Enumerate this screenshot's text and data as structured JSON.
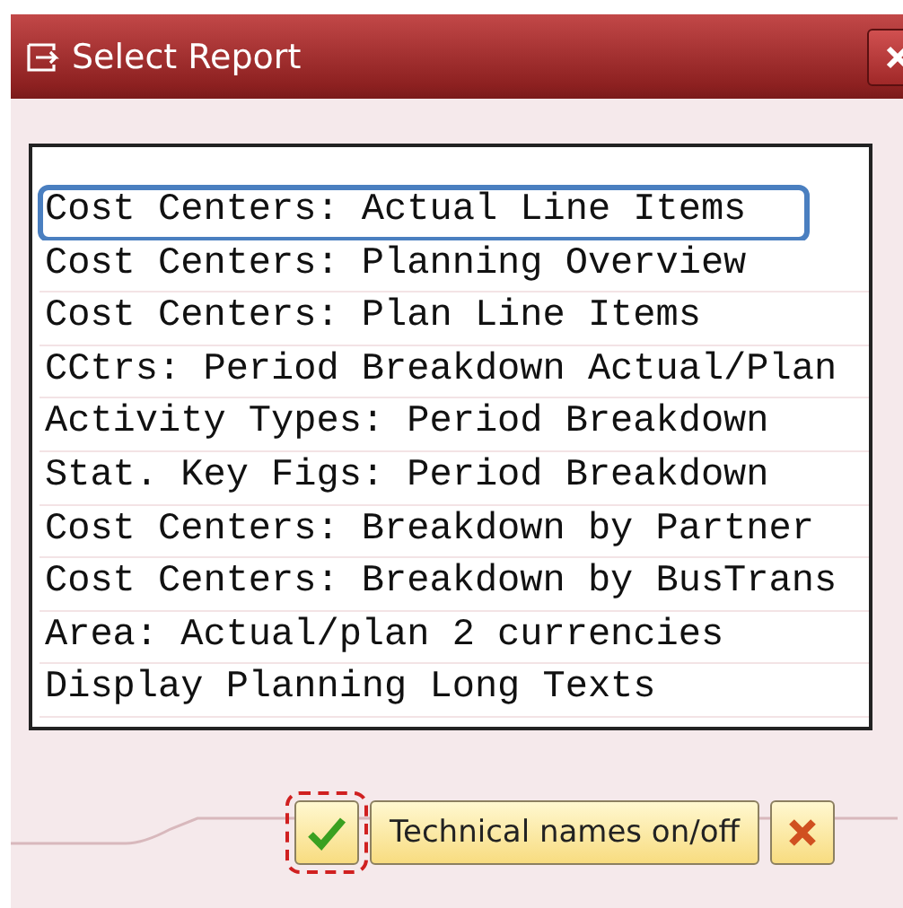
{
  "window": {
    "title": "Select Report"
  },
  "reports": [
    {
      "label": "Cost Centers: Actual Line Items",
      "selected": true
    },
    {
      "label": "Cost Centers: Planning Overview",
      "selected": false
    },
    {
      "label": "Cost Centers: Plan Line Items",
      "selected": false
    },
    {
      "label": "CCtrs: Period Breakdown Actual/Plan",
      "selected": false
    },
    {
      "label": "Activity Types: Period Breakdown",
      "selected": false
    },
    {
      "label": "Stat. Key Figs: Period Breakdown",
      "selected": false
    },
    {
      "label": "Cost Centers: Breakdown by Partner",
      "selected": false
    },
    {
      "label": "Cost Centers: Breakdown by BusTrans",
      "selected": false
    },
    {
      "label": "Area: Actual/plan 2 currencies",
      "selected": false
    },
    {
      "label": "Display Planning Long Texts",
      "selected": false
    }
  ],
  "buttons": {
    "technical_names": "Technical names on/off"
  }
}
